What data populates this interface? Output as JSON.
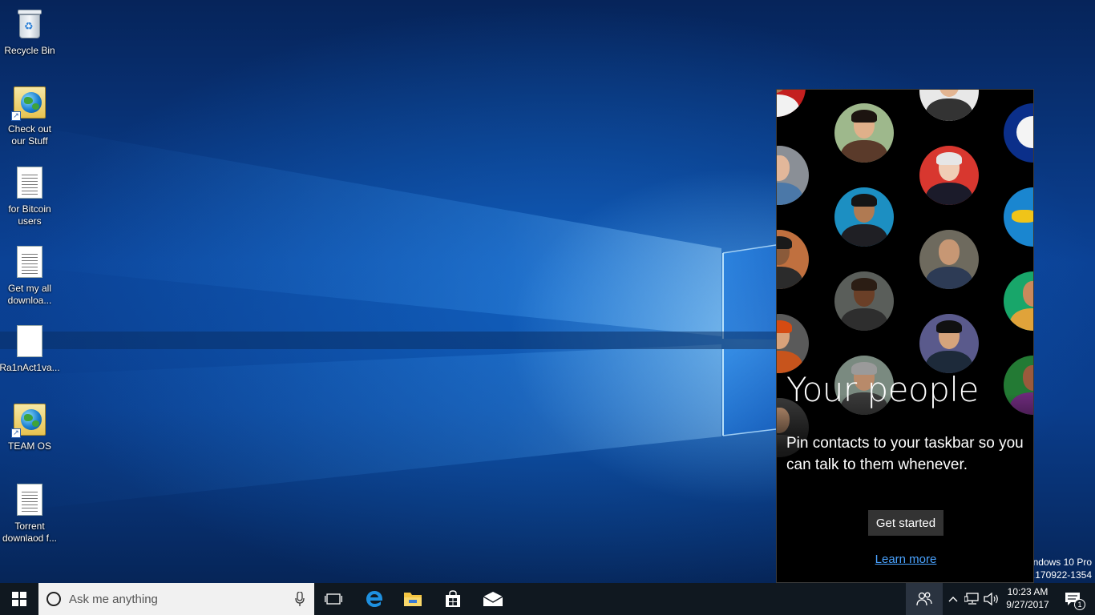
{
  "desktop": {
    "icons": [
      {
        "label": "Recycle Bin",
        "type": "recycle-bin"
      },
      {
        "label": "Check out\nour Stuff",
        "type": "shortcut"
      },
      {
        "label": "for Bitcoin\nusers",
        "type": "text-document"
      },
      {
        "label": "Get my all\ndownloa...",
        "type": "text-document"
      },
      {
        "label": "Ra1nAct1va...",
        "type": "blank-document"
      },
      {
        "label": "TEAM OS",
        "type": "shortcut"
      },
      {
        "label": "Torrent\ndownlaod f...",
        "type": "text-document"
      }
    ],
    "watermark": {
      "line1": "ndows 10 Pro",
      "line2": "e.170922-1354"
    }
  },
  "people_flyout": {
    "title": "Your people",
    "description": "Pin contacts to your taskbar so you can talk to them whenever.",
    "primary_button": "Get started",
    "link": "Learn more"
  },
  "taskbar": {
    "search_placeholder": "Ask me anything",
    "pinned_apps": [
      "task-view",
      "microsoft-edge",
      "file-explorer",
      "microsoft-store",
      "mail"
    ],
    "clock": {
      "time": "10:23 AM",
      "date": "9/27/2017"
    },
    "notification_count": "1"
  },
  "colors": {
    "accent_link": "#4aa3ff",
    "taskbar_bg": "#101820",
    "flyout_bg": "#000000",
    "button_bg": "#333333"
  }
}
